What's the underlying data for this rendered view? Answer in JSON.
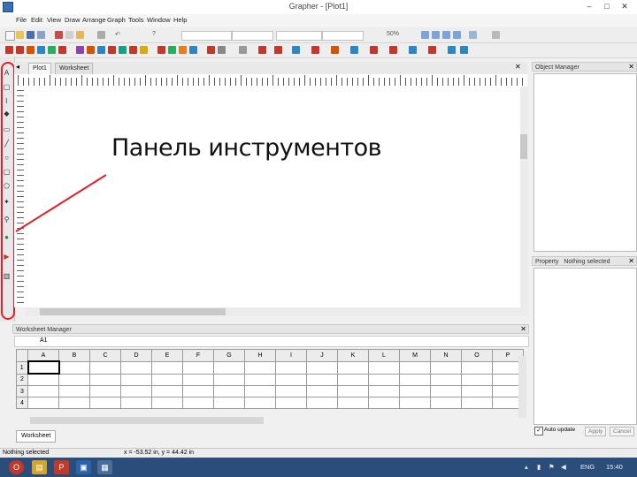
{
  "window": {
    "title": "Grapher - [Plot1]",
    "min": "–",
    "max": "□",
    "close": "✕"
  },
  "menu": [
    "File",
    "Edit",
    "View",
    "Draw",
    "Arrange",
    "Graph",
    "Tools",
    "Window",
    "Help"
  ],
  "toolbar": {
    "undo_label": "↶",
    "zoom_label": "50%"
  },
  "doc_tabs": [
    "Plot1",
    "Worksheet"
  ],
  "plot": {
    "label": "Панель инструментов"
  },
  "object_manager": {
    "title": "Object Manager"
  },
  "properties": {
    "title": "Property",
    "subtitle": "Nothing selected",
    "auto_update": "Auto update",
    "apply": "Apply",
    "cancel": "Cancel"
  },
  "worksheet_manager": {
    "title": "Worksheet Manager",
    "cell_ref": "A1",
    "columns": [
      "A",
      "B",
      "C",
      "D",
      "E",
      "F",
      "G",
      "H",
      "I",
      "J",
      "K",
      "L",
      "M",
      "N",
      "O",
      "P"
    ],
    "rows": [
      "1",
      "2",
      "3",
      "4"
    ],
    "sheet_tab": "Worksheet"
  },
  "status": {
    "left": "Nothing selected",
    "coords": "x = -53.52 in, y = 44.42 in"
  },
  "taskbar": {
    "lang": "ENG",
    "time": "15:40"
  },
  "colors": {
    "annotation": "#e0202a"
  }
}
